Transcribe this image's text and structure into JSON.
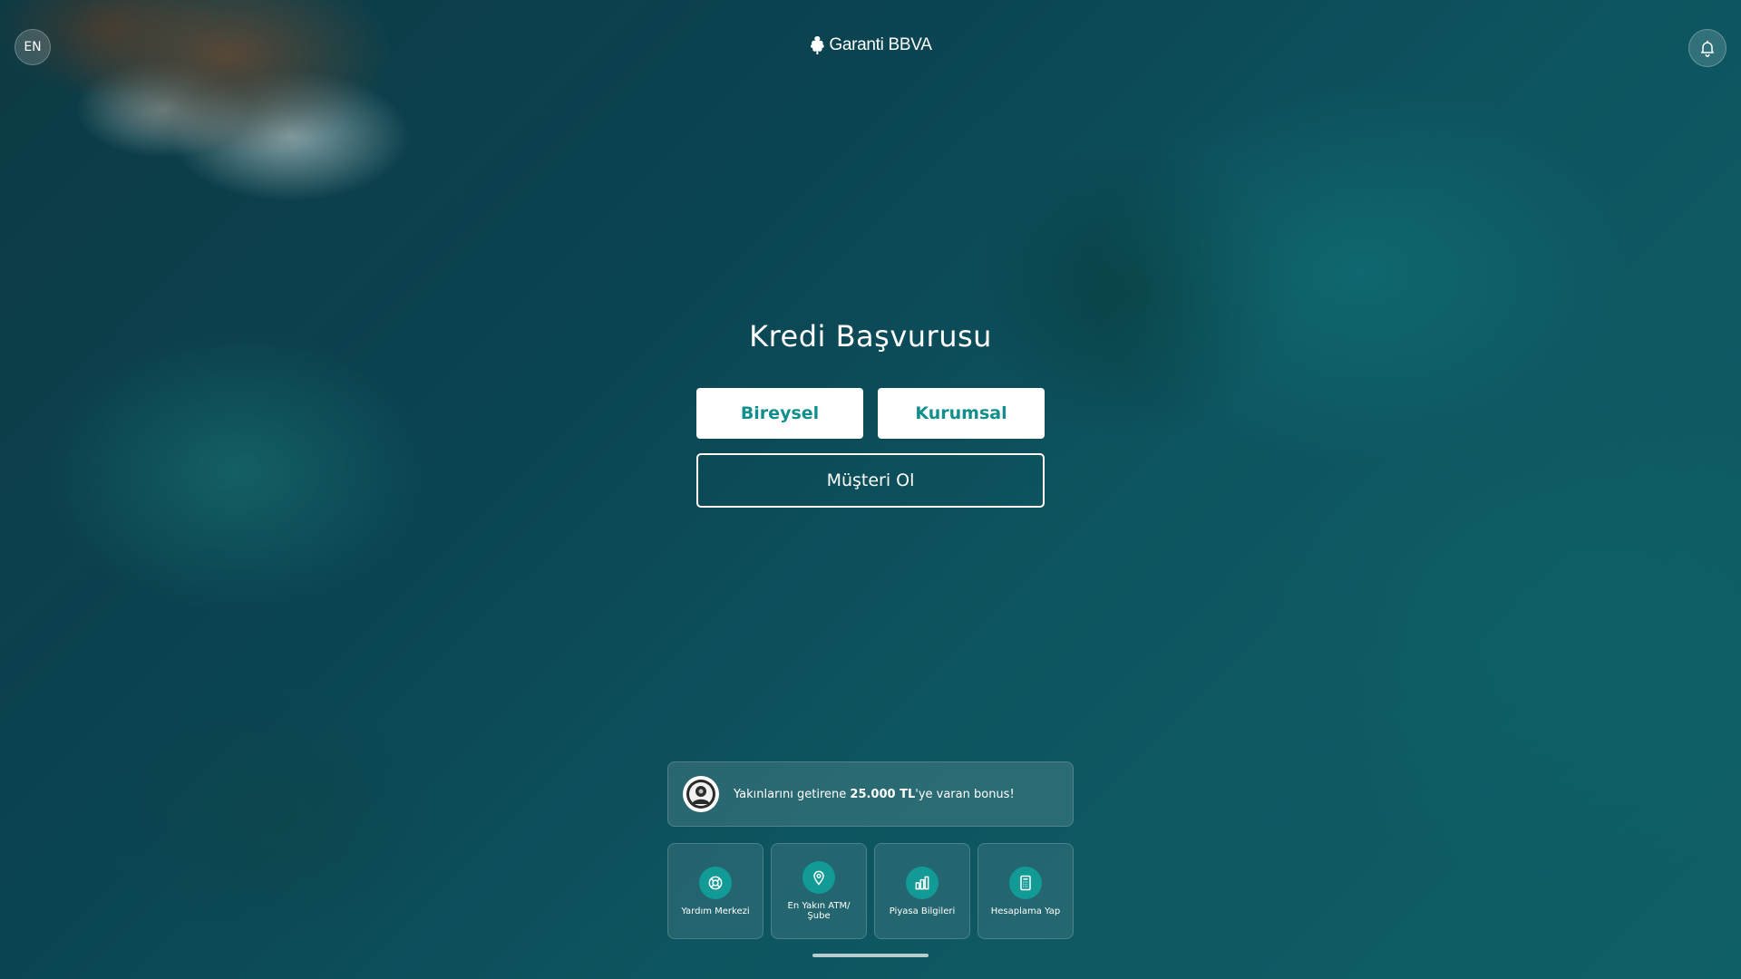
{
  "header": {
    "language_label": "EN",
    "logo_text": "Garanti BBVA",
    "notification_icon": "bell-icon"
  },
  "main": {
    "title": "Kredi Başvurusu",
    "individual_button": "Bireysel",
    "corporate_button": "Kurumsal",
    "become_customer_button": "Müşteri Ol"
  },
  "promo": {
    "text_before": "Yakınlarını getirene ",
    "text_bold": "25.000 TL",
    "text_after": "'ye varan bonus!",
    "icon": "avatar-icon"
  },
  "quick_links": [
    {
      "label": "Yardım Merkezi",
      "icon": "help-lifebuoy-icon"
    },
    {
      "label": "En Yakın ATM/ Şube",
      "icon": "location-pin-icon"
    },
    {
      "label": "Piyasa Bilgileri",
      "icon": "bar-chart-icon"
    },
    {
      "label": "Hesaplama Yap",
      "icon": "calculator-icon"
    }
  ],
  "colors": {
    "accent": "#129a97",
    "button_text": "#118f8d"
  }
}
